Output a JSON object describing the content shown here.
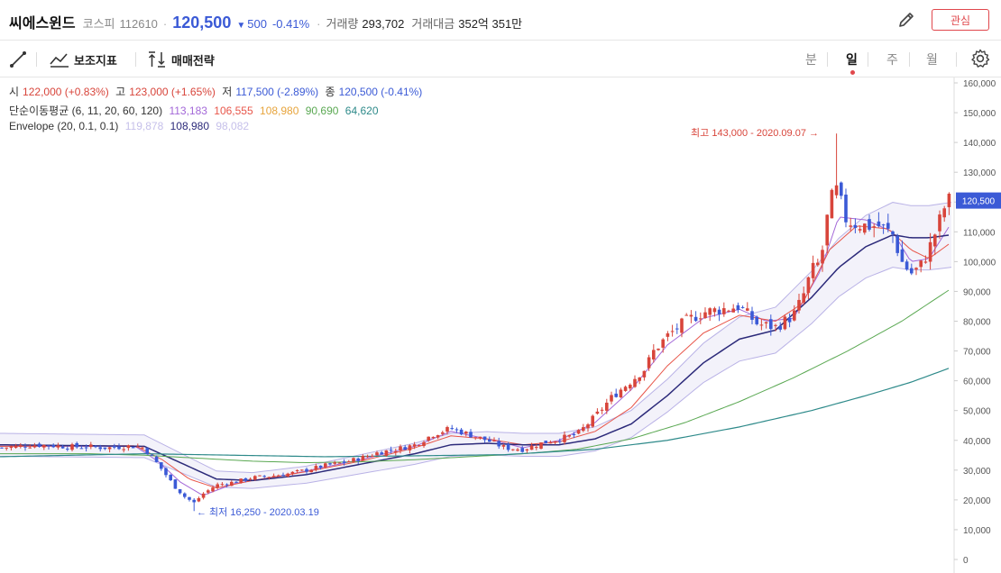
{
  "header": {
    "name": "씨에스윈드",
    "market": "코스피",
    "code": "112610",
    "price": "120,500",
    "change": "500",
    "change_pct": "-0.41%",
    "volume_label": "거래량",
    "volume": "293,702",
    "amount_label": "거래대금",
    "amount": "352억 351만",
    "favorite_label": "관심",
    "separator": "·"
  },
  "toolbar": {
    "indicator_label": "보조지표",
    "strategy_label": "매매전략",
    "periods": [
      "분",
      "일",
      "주",
      "월"
    ],
    "active_period": "일"
  },
  "info": {
    "open_label": "시",
    "open": "122,000 (+0.83%)",
    "high_label": "고",
    "high": "123,000 (+1.65%)",
    "low_label": "저",
    "low": "117,500 (-2.89%)",
    "close_label": "종",
    "close": "120,500 (-0.41%)",
    "ma_label": "단순이동평균 (6, 11, 20, 60, 120)",
    "ma_values": [
      "113,183",
      "106,555",
      "108,980",
      "90,690",
      "64,620"
    ],
    "env_label": "Envelope (20, 0.1, 0.1)",
    "env_values": [
      "119,878",
      "108,980",
      "98,082"
    ]
  },
  "colors": {
    "up": "#d8453b",
    "down": "#3b5ad6",
    "ma6": "#a368d8",
    "ma11": "#e8564a",
    "ma20": "#e7a43c",
    "ma60": "#5aa852",
    "ma120": "#2e8a8a",
    "env_upper": "#b9b2e6",
    "env_mid": "#2c2a7a",
    "env_lower": "#b9b2e6"
  },
  "chart_data": {
    "type": "candlestick",
    "ylim": [
      0,
      160000
    ],
    "y_ticks": [
      "160,000",
      "150,000",
      "140,000",
      "130,000",
      "120,000",
      "110,000",
      "100,000",
      "90,000",
      "80,000",
      "70,000",
      "60,000",
      "50,000",
      "40,000",
      "30,000",
      "20,000",
      "10,000",
      "0"
    ],
    "current_price_label": "120,500",
    "current_price": 120500,
    "annotations": {
      "high": "최고 143,000 - 2020.09.07 →",
      "low": "← 최저 16,250 - 2020.03.19"
    },
    "high_value": 143000,
    "low_value": 16250,
    "close_path": [
      [
        0,
        37500
      ],
      [
        20,
        38000
      ],
      [
        40,
        38500
      ],
      [
        60,
        38200
      ],
      [
        80,
        37800
      ],
      [
        100,
        37800
      ],
      [
        120,
        37500
      ],
      [
        140,
        38000
      ],
      [
        150,
        38000
      ],
      [
        160,
        37500
      ],
      [
        175,
        32000
      ],
      [
        185,
        28000
      ],
      [
        195,
        24000
      ],
      [
        205,
        21000
      ],
      [
        215,
        19000
      ],
      [
        225,
        22000
      ],
      [
        240,
        25000
      ],
      [
        260,
        26000
      ],
      [
        280,
        27500
      ],
      [
        300,
        28000
      ],
      [
        320,
        28800
      ],
      [
        340,
        30000
      ],
      [
        360,
        31500
      ],
      [
        380,
        32500
      ],
      [
        400,
        34000
      ],
      [
        420,
        36000
      ],
      [
        440,
        37000
      ],
      [
        460,
        38500
      ],
      [
        480,
        42000
      ],
      [
        500,
        44000
      ],
      [
        520,
        42000
      ],
      [
        540,
        40000
      ],
      [
        560,
        37500
      ],
      [
        580,
        37000
      ],
      [
        600,
        39000
      ],
      [
        620,
        40500
      ],
      [
        640,
        42000
      ],
      [
        660,
        48000
      ],
      [
        680,
        55000
      ],
      [
        700,
        60000
      ],
      [
        715,
        64000
      ],
      [
        725,
        70000
      ],
      [
        740,
        75000
      ],
      [
        760,
        80000
      ],
      [
        780,
        83000
      ],
      [
        800,
        84000
      ],
      [
        820,
        85000
      ],
      [
        840,
        79000
      ],
      [
        860,
        78000
      ],
      [
        880,
        82000
      ],
      [
        890,
        88000
      ],
      [
        900,
        97000
      ],
      [
        910,
        100000
      ],
      [
        920,
        120000
      ],
      [
        930,
        125000
      ],
      [
        935,
        115000
      ],
      [
        945,
        113000
      ],
      [
        960,
        112000
      ],
      [
        975,
        112000
      ],
      [
        990,
        109000
      ],
      [
        1000,
        100000
      ],
      [
        1010,
        96000
      ],
      [
        1020,
        98000
      ],
      [
        1030,
        104000
      ],
      [
        1040,
        112000
      ],
      [
        1050,
        120500
      ]
    ],
    "moving_averages": [
      {
        "name": "6",
        "points": [
          [
            0,
            38000
          ],
          [
            150,
            38000
          ],
          [
            175,
            33000
          ],
          [
            200,
            26000
          ],
          [
            225,
            21500
          ],
          [
            260,
            25500
          ],
          [
            320,
            28500
          ],
          [
            400,
            33500
          ],
          [
            460,
            38000
          ],
          [
            500,
            43000
          ],
          [
            540,
            40500
          ],
          [
            580,
            37500
          ],
          [
            620,
            40000
          ],
          [
            660,
            46000
          ],
          [
            700,
            57000
          ],
          [
            740,
            72000
          ],
          [
            780,
            81000
          ],
          [
            820,
            84000
          ],
          [
            850,
            80000
          ],
          [
            880,
            81000
          ],
          [
            910,
            97000
          ],
          [
            930,
            115000
          ],
          [
            960,
            114000
          ],
          [
            990,
            110000
          ],
          [
            1010,
            100000
          ],
          [
            1030,
            101000
          ],
          [
            1055,
            113000
          ]
        ]
      },
      {
        "name": "11",
        "points": [
          [
            0,
            38000
          ],
          [
            150,
            38200
          ],
          [
            180,
            33500
          ],
          [
            210,
            27000
          ],
          [
            240,
            24000
          ],
          [
            280,
            26500
          ],
          [
            340,
            29500
          ],
          [
            400,
            33000
          ],
          [
            460,
            37500
          ],
          [
            500,
            41500
          ],
          [
            540,
            40500
          ],
          [
            580,
            38500
          ],
          [
            620,
            39500
          ],
          [
            660,
            43000
          ],
          [
            700,
            51000
          ],
          [
            740,
            65000
          ],
          [
            780,
            76000
          ],
          [
            820,
            82000
          ],
          [
            860,
            80000
          ],
          [
            890,
            86000
          ],
          [
            920,
            104000
          ],
          [
            950,
            112000
          ],
          [
            985,
            111000
          ],
          [
            1010,
            104000
          ],
          [
            1030,
            101000
          ],
          [
            1055,
            106500
          ]
        ]
      },
      {
        "name": "20",
        "points": [
          [
            0,
            38500
          ],
          [
            160,
            38000
          ],
          [
            200,
            32500
          ],
          [
            240,
            27000
          ],
          [
            280,
            26500
          ],
          [
            340,
            28500
          ],
          [
            400,
            32000
          ],
          [
            460,
            35500
          ],
          [
            500,
            38500
          ],
          [
            540,
            39000
          ],
          [
            580,
            38500
          ],
          [
            620,
            38500
          ],
          [
            660,
            40500
          ],
          [
            700,
            45500
          ],
          [
            740,
            55000
          ],
          [
            780,
            66000
          ],
          [
            820,
            74000
          ],
          [
            860,
            77000
          ],
          [
            900,
            88000
          ],
          [
            930,
            98000
          ],
          [
            960,
            105000
          ],
          [
            990,
            109000
          ],
          [
            1010,
            108000
          ],
          [
            1030,
            108000
          ],
          [
            1055,
            109000
          ]
        ]
      },
      {
        "name": "60",
        "points": [
          [
            0,
            35500
          ],
          [
            100,
            35500
          ],
          [
            160,
            35000
          ],
          [
            220,
            34000
          ],
          [
            280,
            33000
          ],
          [
            340,
            32500
          ],
          [
            400,
            32800
          ],
          [
            460,
            33500
          ],
          [
            520,
            34500
          ],
          [
            580,
            35500
          ],
          [
            640,
            37000
          ],
          [
            700,
            40500
          ],
          [
            760,
            46000
          ],
          [
            820,
            53000
          ],
          [
            880,
            61000
          ],
          [
            940,
            70000
          ],
          [
            1000,
            80000
          ],
          [
            1055,
            91000
          ]
        ]
      },
      {
        "name": "120",
        "points": [
          [
            0,
            34500
          ],
          [
            160,
            35500
          ],
          [
            260,
            35000
          ],
          [
            360,
            34500
          ],
          [
            460,
            34800
          ],
          [
            560,
            35200
          ],
          [
            660,
            37000
          ],
          [
            740,
            40000
          ],
          [
            820,
            44500
          ],
          [
            900,
            50000
          ],
          [
            960,
            55000
          ],
          [
            1010,
            59500
          ],
          [
            1055,
            64500
          ]
        ]
      }
    ]
  }
}
